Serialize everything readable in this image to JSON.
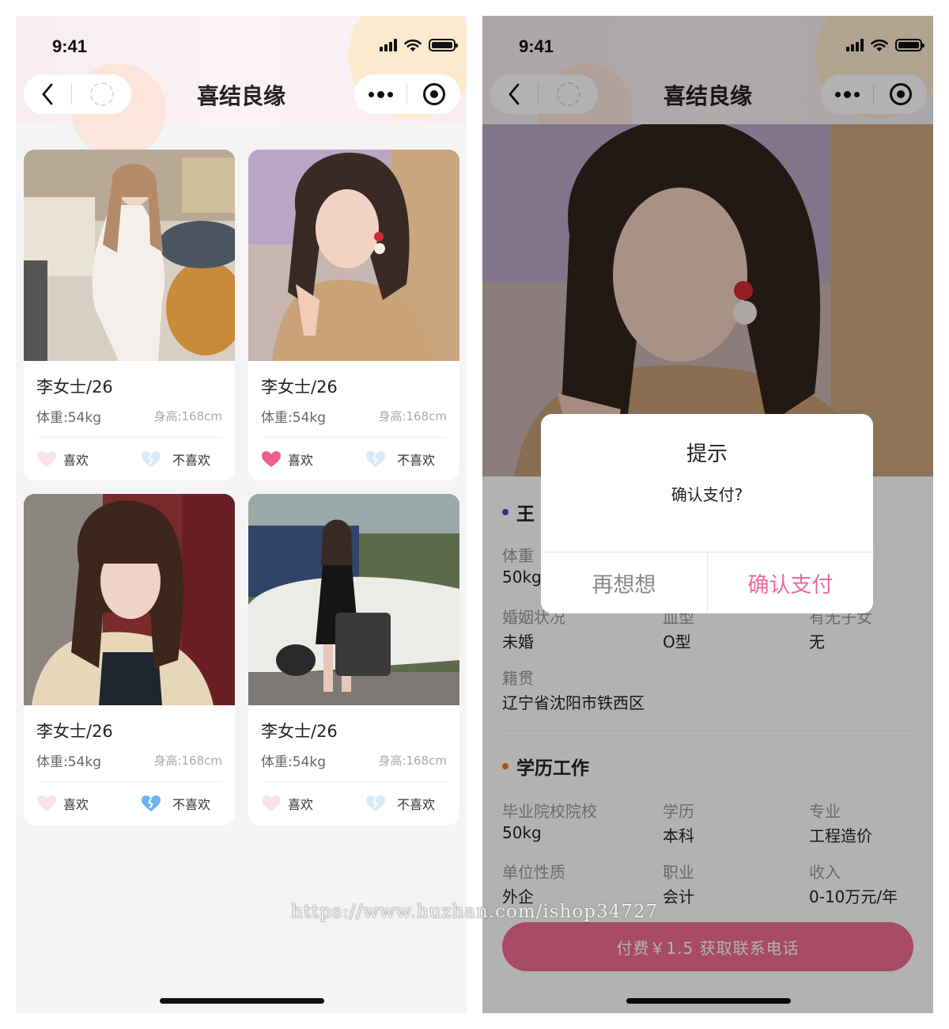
{
  "status_bar": {
    "time": "9:41"
  },
  "nav": {
    "title": "喜结良缘"
  },
  "colors": {
    "accent_pink": "#f06b93",
    "blue_heart": "#6ab4ef",
    "section_dot_basic": "#4a3ccf",
    "section_dot_edu": "#f07820"
  },
  "list_page": {
    "cards": [
      {
        "name": "李女士/26",
        "weight": "体重:54kg",
        "height": "身高:168cm",
        "like_label": "喜欢",
        "dislike_label": "不喜欢",
        "liked": false,
        "disliked": false
      },
      {
        "name": "李女士/26",
        "weight": "体重:54kg",
        "height": "身高:168cm",
        "like_label": "喜欢",
        "dislike_label": "不喜欢",
        "liked": true,
        "disliked": false
      },
      {
        "name": "李女士/26",
        "weight": "体重:54kg",
        "height": "身高:168cm",
        "like_label": "喜欢",
        "dislike_label": "不喜欢",
        "liked": false,
        "disliked": true
      },
      {
        "name": "李女士/26",
        "weight": "体重:54kg",
        "height": "身高:168cm",
        "like_label": "喜欢",
        "dislike_label": "不喜欢",
        "liked": false,
        "disliked": false
      }
    ]
  },
  "detail_page": {
    "basic_title": "王",
    "basic_fields": [
      {
        "label": "体重",
        "value": "50kg"
      },
      {
        "label": "婚姻状况",
        "value": "未婚"
      },
      {
        "label": "血型",
        "value": "O型"
      },
      {
        "label": "有无子女",
        "value": "无"
      },
      {
        "label": "籍贯",
        "value": "辽宁省沈阳市铁西区"
      }
    ],
    "edu_title": "学历工作",
    "edu_fields": [
      {
        "label": "毕业院校院校",
        "value": "50kg"
      },
      {
        "label": "学历",
        "value": "本科"
      },
      {
        "label": "专业",
        "value": "工程造价"
      },
      {
        "label": "单位性质",
        "value": "外企"
      },
      {
        "label": "职业",
        "value": "会计"
      },
      {
        "label": "收入",
        "value": "0-10万元/年"
      }
    ],
    "pay_button": "付费￥1.5 获取联系电话"
  },
  "dialog": {
    "title": "提示",
    "message": "确认支付?",
    "cancel": "再想想",
    "confirm": "确认支付"
  },
  "watermark": "https://www.huzhan.com/ishop34727"
}
